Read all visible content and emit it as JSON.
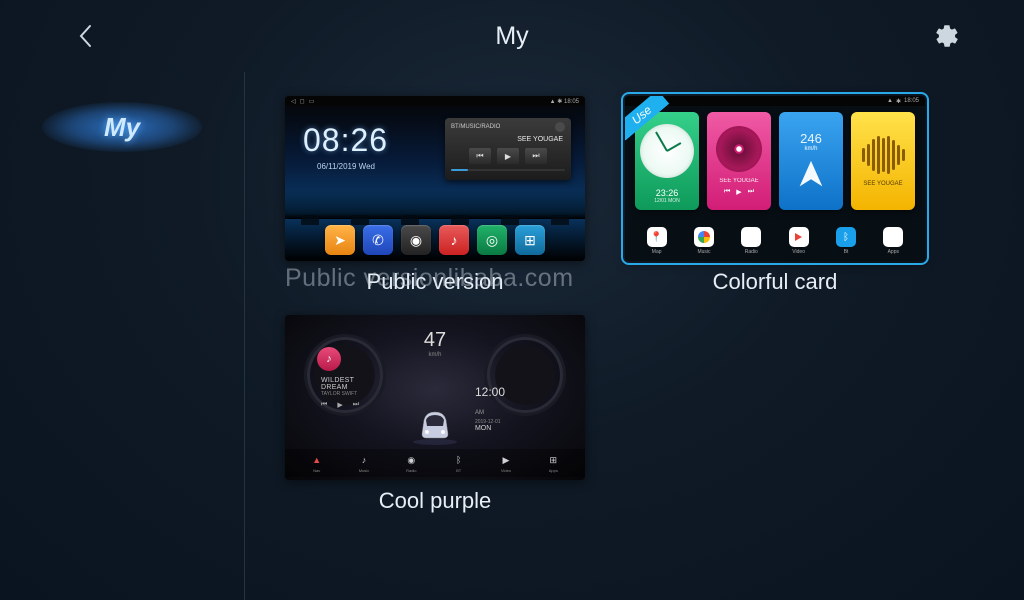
{
  "header": {
    "title": "My"
  },
  "sidebar": {
    "tabs": [
      {
        "label": "My",
        "active": true
      }
    ]
  },
  "themes": [
    {
      "id": "public",
      "label": "Public version",
      "selected": false,
      "in_use": false,
      "preview": {
        "status_time": "18:05",
        "clock": "08:26",
        "date": "06/11/2019 Wed",
        "player_header": "BT/MUSIC/RADIO",
        "player_track": "SEE YOUGAE"
      }
    },
    {
      "id": "colorful",
      "label": "Colorful card",
      "selected": true,
      "in_use": true,
      "use_badge": "Use",
      "preview": {
        "status_time": "18:05",
        "card_time": "23:26",
        "card_date": "12/01 MON",
        "card_track": "SEE YOUGAE",
        "card_speed": "246",
        "card_speed_unit": "km/h",
        "card_radio": "SEE YOUGAE",
        "dock": [
          "Map",
          "Music",
          "Radio",
          "Video",
          "Bt",
          "Apps"
        ]
      }
    },
    {
      "id": "coolpurple",
      "label": "Cool purple",
      "selected": false,
      "in_use": false,
      "preview": {
        "speed": "47",
        "speed_unit": "km/h",
        "song": "WILDEST DREAM",
        "artist": "TAYLOR SWIFT",
        "time": "12:00",
        "ampm": "AM",
        "date": "2019-12-01",
        "day": "MON",
        "dock": [
          "Nav",
          "Music",
          "Radio",
          "BT",
          "Video",
          "Apps"
        ]
      }
    }
  ],
  "watermark": "Public versionlibaba.com"
}
